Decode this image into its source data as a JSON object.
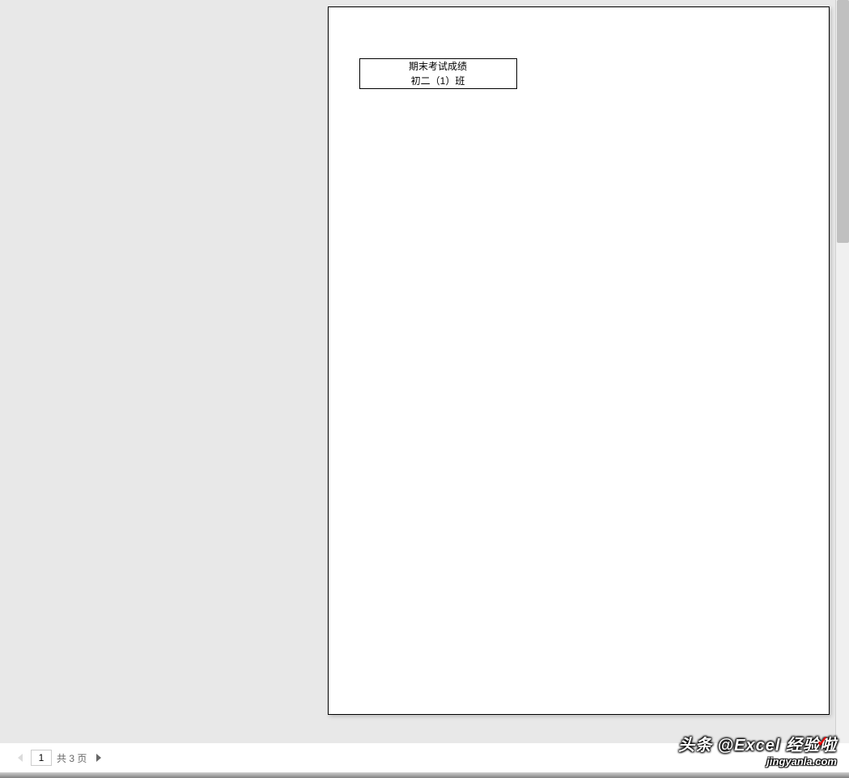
{
  "page_content": {
    "title_line1": "期末考试成绩",
    "title_line2": "初二（1）班"
  },
  "pagination": {
    "current_page": "1",
    "total_label": "共 3 页"
  },
  "watermark": {
    "text": "头条 @Excel 经验啦",
    "url": "jingyanla.com"
  }
}
